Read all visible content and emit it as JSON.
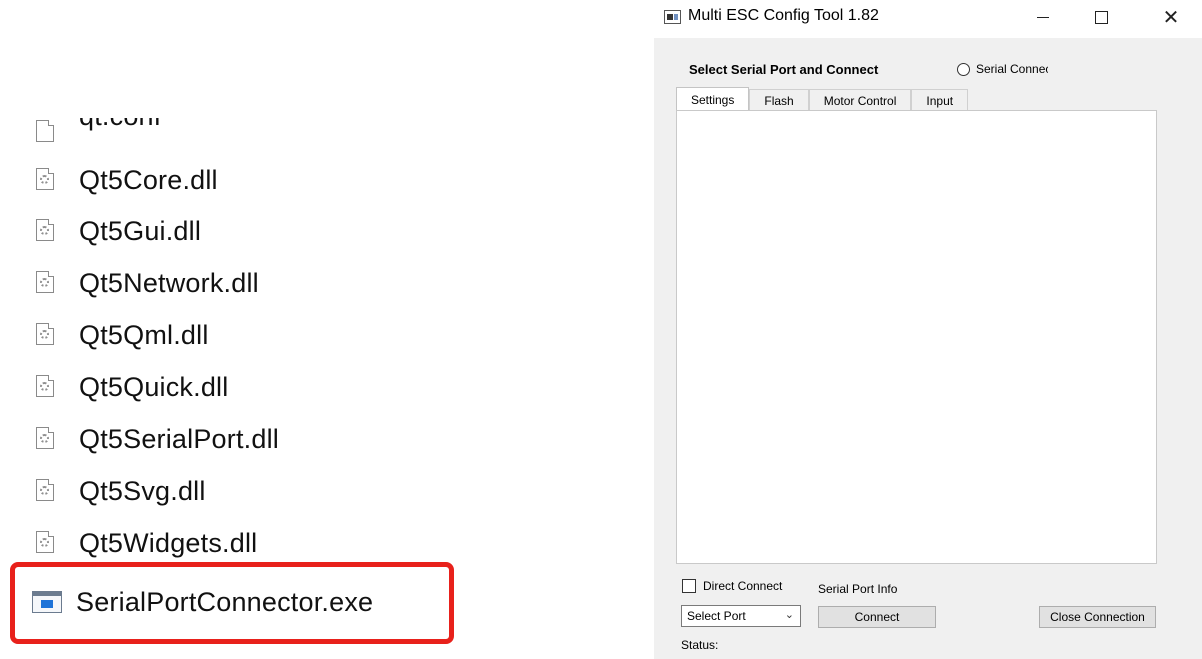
{
  "files": {
    "partial_item": "qt.conf",
    "items": [
      {
        "name": "Qt5Core.dll"
      },
      {
        "name": "Qt5Gui.dll"
      },
      {
        "name": "Qt5Network.dll"
      },
      {
        "name": "Qt5Qml.dll"
      },
      {
        "name": "Qt5Quick.dll"
      },
      {
        "name": "Qt5SerialPort.dll"
      },
      {
        "name": "Qt5Svg.dll"
      },
      {
        "name": "Qt5Widgets.dll"
      }
    ],
    "highlighted_item": "SerialPortConnector.exe",
    "highlight_color": "#e8211b"
  },
  "window": {
    "title": "Multi ESC Config Tool 1.82",
    "controls": {
      "minimize": "—",
      "maximize": "☐",
      "close": "✕"
    },
    "group_title": "Select Serial Port and Connect",
    "radio_label": "Serial Connected",
    "tabs": [
      {
        "label": "Settings",
        "active": true
      },
      {
        "label": "Flash",
        "active": false
      },
      {
        "label": "Motor Control",
        "active": false
      },
      {
        "label": "Input",
        "active": false
      }
    ],
    "checkbox_label": "Direct Connect",
    "serial_port_info_label": "Serial Port Info",
    "port_select": {
      "value": "Select Port"
    },
    "connect_label": "Connect",
    "close_connection_label": "Close Connection",
    "status_label": "Status:"
  },
  "icons": {
    "file_icon": "dll-file-icon",
    "exe_icon": "exe-window-icon",
    "app_icon": "app-window-icon",
    "chevron": "chevron-down-icon"
  }
}
